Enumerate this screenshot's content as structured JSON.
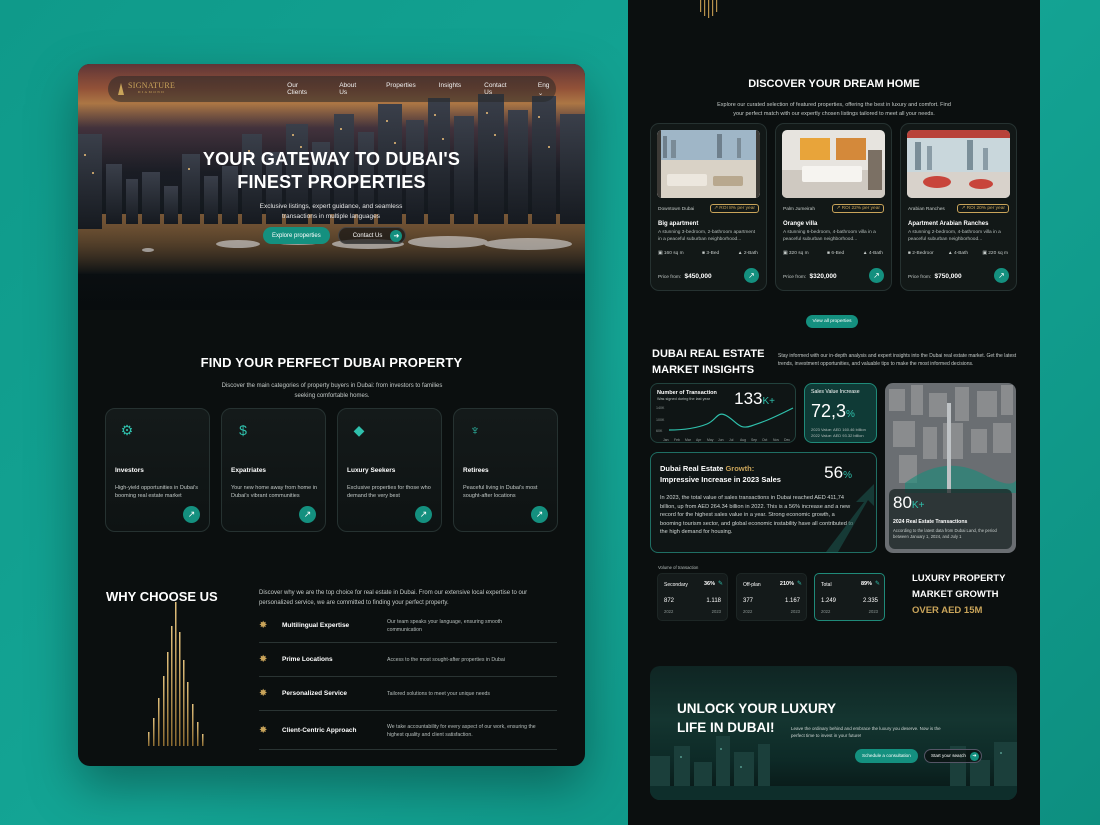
{
  "left": {
    "nav": {
      "logo": "SIGNATURE",
      "logo_sub": "DIAMOND",
      "links": [
        "Our Clients",
        "About Us",
        "Properties",
        "Insights",
        "Contact Us"
      ],
      "lang": "Eng"
    },
    "hero": {
      "title_line1": "YOUR GATEWAY TO DUBAI'S",
      "title_line2": "FINEST PROPERTIES",
      "subtitle": "Exclusive listings, expert guidance, and seamless transactions in multiple languages",
      "btn_explore": "Explore properties",
      "btn_contact": "Contact Us"
    },
    "find": {
      "title": "FIND YOUR PERFECT DUBAI PROPERTY",
      "desc": "Discover the main categories of property buyers in Dubai: from investors to families seeking comfortable homes."
    },
    "categories": [
      {
        "icon": "investment-icon",
        "title": "Investors",
        "desc": "High-yield opportunities in Dubai's booming real estate market"
      },
      {
        "icon": "expatriate-icon",
        "title": "Expatriates",
        "desc": "Your new home away from home in Dubai's vibrant communities"
      },
      {
        "icon": "diamond-icon",
        "title": "Luxury Seekers",
        "desc": "Exclusive properties for those who demand the very best"
      },
      {
        "icon": "money-bag-icon",
        "title": "Retirees",
        "desc": "Peaceful living in Dubai's most sought-after locations"
      }
    ],
    "why": {
      "title": "WHY CHOOSE US",
      "desc": "Discover why we are the top choice for real estate in Dubai. From our extensive local expertise to our personalized service, we are committed to finding your perfect property.",
      "features": [
        {
          "title": "Multilingual Expertise",
          "desc": "Our team speaks your language, ensuring smooth communication"
        },
        {
          "title": "Prime Locations",
          "desc": "Access to the most sought-after properties in Dubai"
        },
        {
          "title": "Personalized Service",
          "desc": "Tailored solutions to meet your unique needs"
        },
        {
          "title": "Client-Centric Approach",
          "desc": "We take accountability for every aspect of our work, ensuring the highest quality and client satisfaction."
        }
      ]
    }
  },
  "right": {
    "dream": {
      "title": "DISCOVER YOUR DREAM HOME",
      "desc": "Explore our curated selection of featured properties, offering the best in luxury and comfort. Find your perfect match with our expertly chosen listings tailored to meet all your needs."
    },
    "properties": [
      {
        "location": "Downtown Dubai",
        "roi": "ROI 8% per year",
        "name": "Big apartment",
        "desc": "A stunning 3-bedroom, 2-bathroom apartment in a peaceful suburban neighborhood...",
        "area": "160 sq m",
        "beds": "3-Bed",
        "baths": "2-Bath",
        "price_label": "Price from",
        "price": "$450,000"
      },
      {
        "location": "Palm Jumeirah",
        "roi": "ROI 22% per year",
        "name": "Orange villa",
        "desc": "A stunning 6-bedroom, 4-bathroom villa in a peaceful suburban neighborhood...",
        "area": "320 sq m",
        "beds": "6-Bed",
        "baths": "4-Bath",
        "price_label": "Price from",
        "price": "$320,000"
      },
      {
        "location": "Arabian Ranches",
        "roi": "ROI 20% per year",
        "name": "Apartment Arabian Ranches",
        "desc": "A stunning 2-bedroom, 4-bathroom villa in a peaceful suburban neighborhood...",
        "area": "220 sq m",
        "beds": "2-Bedroor",
        "baths": "4-Bath",
        "price_label": "Price from",
        "price": "$750,000"
      }
    ],
    "view_all": "View all properties",
    "insights": {
      "title_line1": "DUBAI REAL ESTATE",
      "title_line2": "MARKET INSIGHTS",
      "desc": "Stay informed with our in-depth analysis and expert insights into the Dubai real estate market. Get the latest trends, investment opportunities, and valuable tips to make the most informed decisions."
    },
    "transactions": {
      "label": "Number of Transaction",
      "sub": "Was signed during the last year",
      "big": "133",
      "suffix": "K+",
      "ticks": [
        "140K",
        "100K",
        "60K"
      ],
      "months": [
        "Jan",
        "Feb",
        "Mar",
        "Apr",
        "May",
        "Jun",
        "Jul",
        "Aug",
        "Sep",
        "Oct",
        "Nov",
        "Dec"
      ]
    },
    "sales": {
      "label": "Sales Value Increase",
      "big": "72,3",
      "suffix": "%",
      "note1": "2023 Value: AED 160.46 billion",
      "note2": "2022 Value: AED 93.32 billion"
    },
    "city": {
      "big": "80",
      "suffix": "K+",
      "label": "2024 Real Estate Transactions",
      "note": "According to the latest data from Dubai Land, the period between January 1, 2024, and July 1"
    },
    "growth": {
      "title_pre": "Dubai Real Estate ",
      "title_hl": "Growth:",
      "title_post": "Impressive Increase in 2023 Sales",
      "big": "56",
      "suffix": "%",
      "body": "In 2023, the total value of sales transactions in Dubai reached AED 411,74 billion, up from AED 264.34 billion in 2022. This is a 56% increase and a new record for the highest sales value in a year. Strong economic growth, a booming tourism sector, and global economic instability have all contributed to the high demand for housing."
    },
    "volume": {
      "label": "Volume of transaction",
      "cards": [
        {
          "name": "Secondary",
          "pct": "36%",
          "v1": "872",
          "v2": "1.118",
          "y1": "2022",
          "y2": "2023"
        },
        {
          "name": "Off-plan",
          "pct": "210%",
          "v1": "377",
          "v2": "1.167",
          "y1": "2022",
          "y2": "2023"
        },
        {
          "name": "Total",
          "pct": "89%",
          "v1": "1.249",
          "v2": "2.335",
          "y1": "2022",
          "y2": "2023"
        }
      ]
    },
    "lux": {
      "line1": "LUXURY PROPERTY",
      "line2": "MARKET GROWTH",
      "line3": "OVER AED 15M"
    },
    "cta": {
      "title_line1": "UNLOCK YOUR LUXURY",
      "title_line2": "LIFE IN DUBAI!",
      "desc": "Leave the ordinary behind and embrace the luxury you deserve. Now is the perfect time to invest in your future!",
      "btn1": "Schedule a consultation",
      "btn2": "Start your search"
    }
  }
}
